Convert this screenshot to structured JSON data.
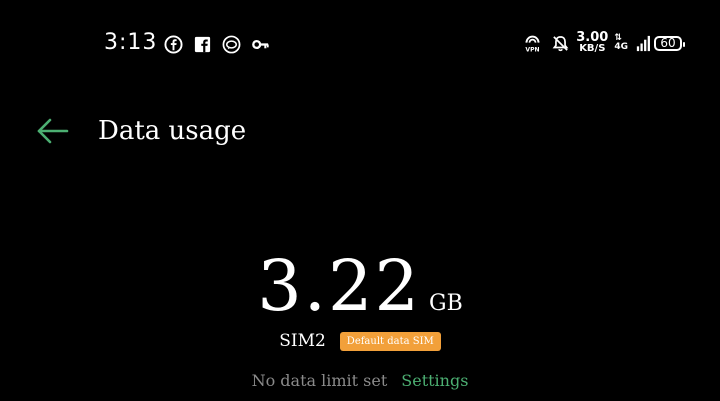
{
  "status_bar": {
    "time": "3:13",
    "notification_icons": [
      "facebook-circle-icon",
      "facebook-square-icon",
      "chat-bubble-icon",
      "key-icon"
    ],
    "vpn_label": "VPN",
    "speed_value": "3.00",
    "speed_unit": "KB/S",
    "network_type": "4G",
    "battery_level": "60"
  },
  "header": {
    "title": "Data usage"
  },
  "usage": {
    "value": "3.22",
    "unit": "GB"
  },
  "sim": {
    "name": "SIM2",
    "badge": "Default data SIM"
  },
  "limit": {
    "text": "No data limit set",
    "settings_label": "Settings"
  },
  "colors": {
    "background": "#000000",
    "accent": "#4caf72",
    "badge": "#f2a03a",
    "muted_text": "#8a8a8a"
  }
}
